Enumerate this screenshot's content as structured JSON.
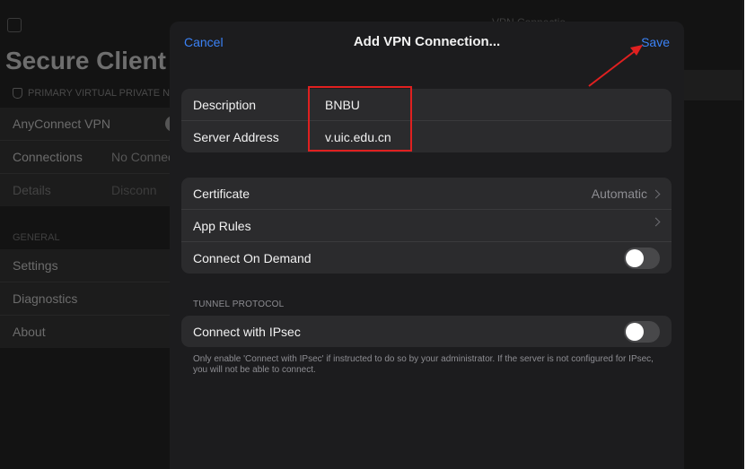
{
  "background_app": {
    "header_partial": "VPN Connectio",
    "title": "Secure Client",
    "section_primary": "PRIMARY VIRTUAL PRIVATE NET",
    "rows_primary": [
      {
        "label": "AnyConnect VPN",
        "value": ""
      },
      {
        "label": "Connections",
        "value": "No Connec"
      },
      {
        "label": "Details",
        "value": "Disconn"
      }
    ],
    "section_general": "GENERAL",
    "rows_general": [
      {
        "label": "Settings"
      },
      {
        "label": "Diagnostics"
      },
      {
        "label": "About"
      }
    ]
  },
  "modal": {
    "cancel_label": "Cancel",
    "title": "Add VPN Connection...",
    "save_label": "Save",
    "fields": {
      "description_label": "Description",
      "description_value": "BNBU",
      "server_label": "Server Address",
      "server_value": "v.uic.edu.cn"
    },
    "options": {
      "certificate_label": "Certificate",
      "certificate_value": "Automatic",
      "app_rules_label": "App Rules",
      "connect_on_demand_label": "Connect On Demand",
      "connect_on_demand_on": false
    },
    "tunnel_section": "TUNNEL PROTOCOL",
    "ipsec_label": "Connect with IPsec",
    "ipsec_on": false,
    "footnote": "Only enable 'Connect with IPsec' if instructed to do so by your administrator. If the server is not configured for IPsec, you will not be able to connect."
  },
  "colors": {
    "accent": "#3b82f6",
    "annotation": "#e02020"
  }
}
